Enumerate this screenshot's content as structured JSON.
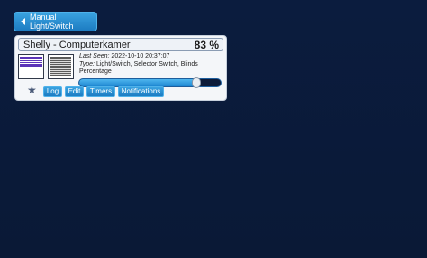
{
  "nav": {
    "back_label": "Manual Light/Switch"
  },
  "device": {
    "name": "Shelly - Computerkamer",
    "level_text": "83 %",
    "level_fraction": 0.83,
    "last_seen_label": "Last Seen:",
    "last_seen_value": "2022-10-10 20:37:07",
    "type_label": "Type:",
    "type_value": "Light/Switch, Selector Switch, Blinds Percentage",
    "icons": [
      "blinds-open-icon",
      "blinds-closed-icon"
    ]
  },
  "actions": {
    "favorite_icon": "star-icon",
    "log": "Log",
    "edit": "Edit",
    "timers": "Timers",
    "notifications": "Notifications"
  },
  "colors": {
    "background": "#0b1c3e",
    "accent": "#1d7cc2",
    "blind_open": "#5b34b8"
  }
}
